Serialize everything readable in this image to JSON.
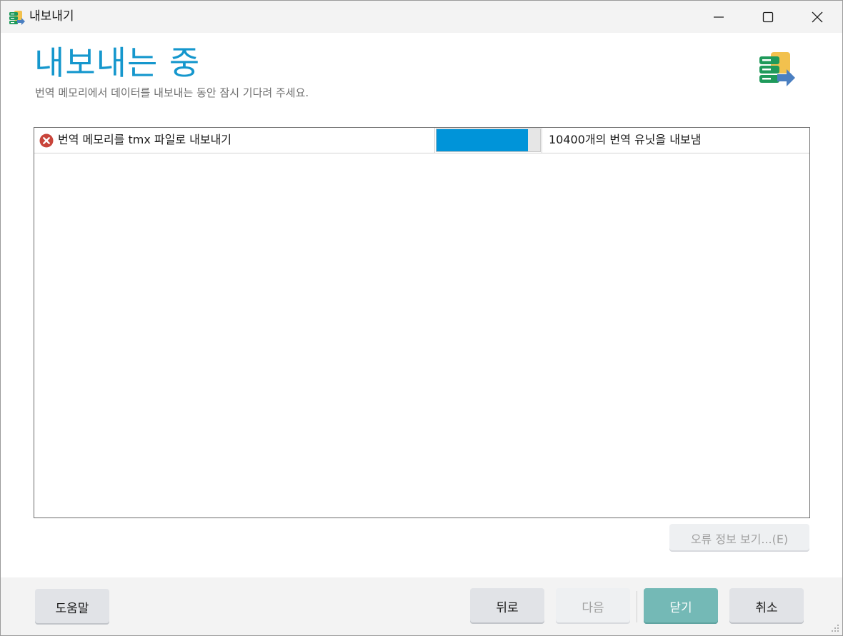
{
  "window": {
    "title": "내보내기",
    "icon": "tm-export-icon"
  },
  "header": {
    "title": "내보내는 중",
    "subtitle": "번역 메모리에서 데이터를 내보내는 동안 잠시 기다려 주세요.",
    "icon": "tm-export-icon"
  },
  "tasks": [
    {
      "label": "번역 메모리를 tmx 파일로 내보내기",
      "status_icon": "error-icon",
      "progress": 0.88,
      "status": "10400개의 번역 유닛을 내보냄"
    }
  ],
  "error_info_button": "오류 정보 보기...(E)",
  "footer": {
    "help": "도움말",
    "back": "뒤로",
    "next": "다음",
    "close": "닫기",
    "cancel": "취소"
  },
  "colors": {
    "accent": "#1597cd",
    "progress": "#0094d9",
    "error": "#c9453b",
    "primary_button": "#74b9b6"
  }
}
